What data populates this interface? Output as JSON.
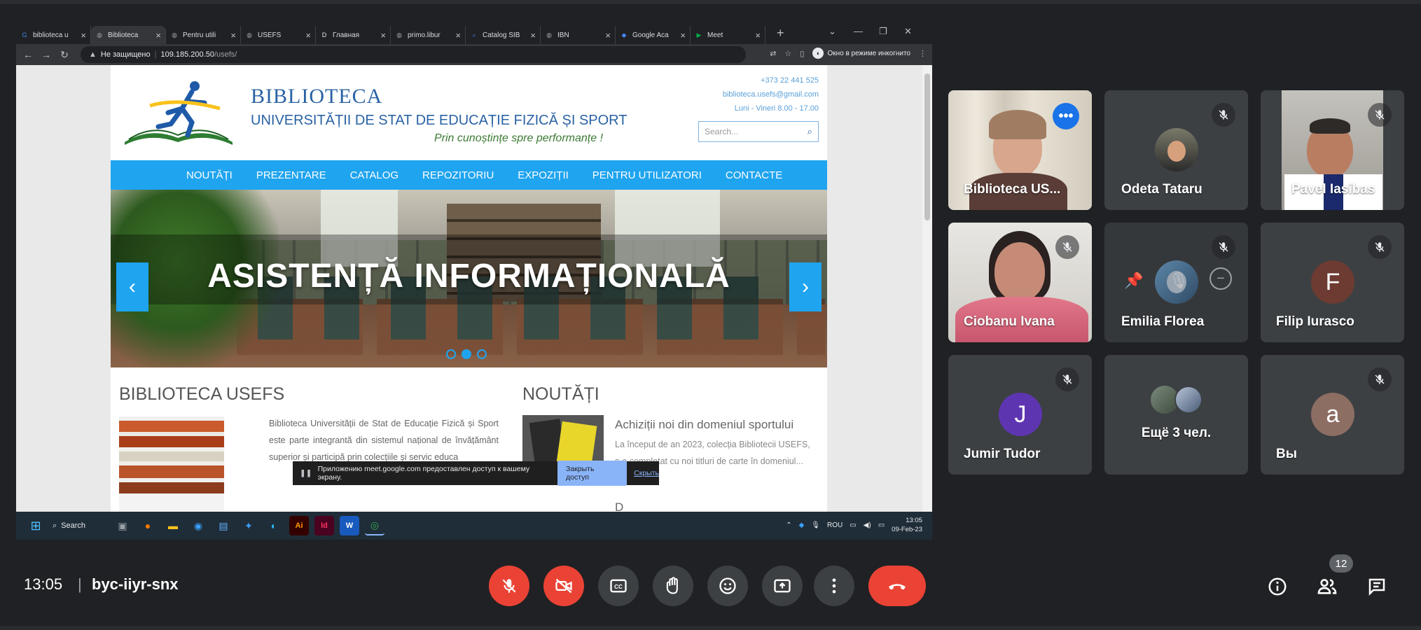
{
  "browser": {
    "tabs": [
      {
        "title": "biblioteca u",
        "favicon": "google-g",
        "color": "#4285f4"
      },
      {
        "title": "Biblioteca",
        "favicon": "globe",
        "color": "#9aa0a6"
      },
      {
        "title": "Pentru utili",
        "favicon": "globe",
        "color": "#9aa0a6"
      },
      {
        "title": "USEFS",
        "favicon": "globe",
        "color": "#9aa0a6"
      },
      {
        "title": "Главная",
        "favicon": "document",
        "color": "#e8eaed"
      },
      {
        "title": "primo.libur",
        "favicon": "globe",
        "color": "#9aa0a6"
      },
      {
        "title": "Catalog SIB",
        "favicon": "magnifier",
        "color": "#4285f4"
      },
      {
        "title": "IBN",
        "favicon": "globe",
        "color": "#9aa0a6"
      },
      {
        "title": "Google Aca",
        "favicon": "scholar",
        "color": "#4285f4"
      },
      {
        "title": "Meet",
        "favicon": "meet",
        "color": "#00ac47"
      }
    ],
    "address": {
      "security": "Не защищено",
      "host": "109.185.200.50",
      "path": "/usefs/"
    },
    "incognito_label": "Окно в режиме инкогнито"
  },
  "site": {
    "title": "BIBLIOTECA",
    "subtitle": "UNIVERSITĂȚII DE STAT DE EDUCAȚIE FIZICĂ ȘI SPORT",
    "motto": "Prin cunoștințe spre performanțe !",
    "phone": "+373 22 441 525",
    "email": "biblioteca.usefs@gmail.com",
    "hours": "Luni - Vineri 8.00 - 17.00",
    "search_placeholder": "Search...",
    "nav": [
      "NOUTĂȚI",
      "PREZENTARE",
      "CATALOG",
      "REPOZITORIU",
      "EXPOZIȚII",
      "PENTRU UTILIZATORI",
      "CONTACTE"
    ],
    "banner_title": "ASISTENȚĂ INFORMAȚIONALĂ",
    "banner_active_slide": 2,
    "banner_slide_count": 3,
    "section_library": "BIBLIOTECA USEFS",
    "library_text": "Biblioteca Universității de Stat de Educație Fizică și Sport este parte integrantă din sistemul național de învățământ superior și participă prin colecțiile și servic educa",
    "section_news": "NOUTĂȚI",
    "news_title": "Achiziții noi din domeniul sportului",
    "news_text": "La început de an 2023, colecția Bibliotecii USEFS, s-a completat cu noi titluri de carte în domeniul...",
    "news_second_title": "D"
  },
  "share_bar": {
    "message": "Приложению meet.google.com предоставлен доступ к вашему экрану.",
    "stop_label": "Закрыть доступ",
    "hide_label": "Скрыть"
  },
  "taskbar": {
    "search_label": "Search",
    "language": "ROU",
    "time": "13:05",
    "date": "09-Feb-23"
  },
  "participants": [
    {
      "name": "Biblioteca US...",
      "type": "video",
      "muted": false,
      "speaking": true
    },
    {
      "name": "Odeta Tataru",
      "type": "photo",
      "muted": true
    },
    {
      "name": "Pavel Iasibas",
      "type": "video",
      "muted": true
    },
    {
      "name": "Ciobanu Ivana",
      "type": "video",
      "muted": true
    },
    {
      "name": "Emilia Florea",
      "type": "photo",
      "muted": true,
      "pinned_controls": true
    },
    {
      "name": "Filip Iurasco",
      "type": "initial",
      "initial": "F",
      "avatar_color": "#6d3b32",
      "muted": true
    },
    {
      "name": "Jumir Tudor",
      "type": "initial",
      "initial": "J",
      "avatar_color": "#5e35b1",
      "muted": true
    },
    {
      "name": "Ещё 3 чел.",
      "type": "group",
      "muted": false
    },
    {
      "name": "Вы",
      "type": "initial",
      "initial": "a",
      "avatar_color": "#8d6e63",
      "muted": true
    }
  ],
  "meeting": {
    "time": "13:05",
    "code": "byc-iiyr-snx",
    "people_count": "12"
  }
}
